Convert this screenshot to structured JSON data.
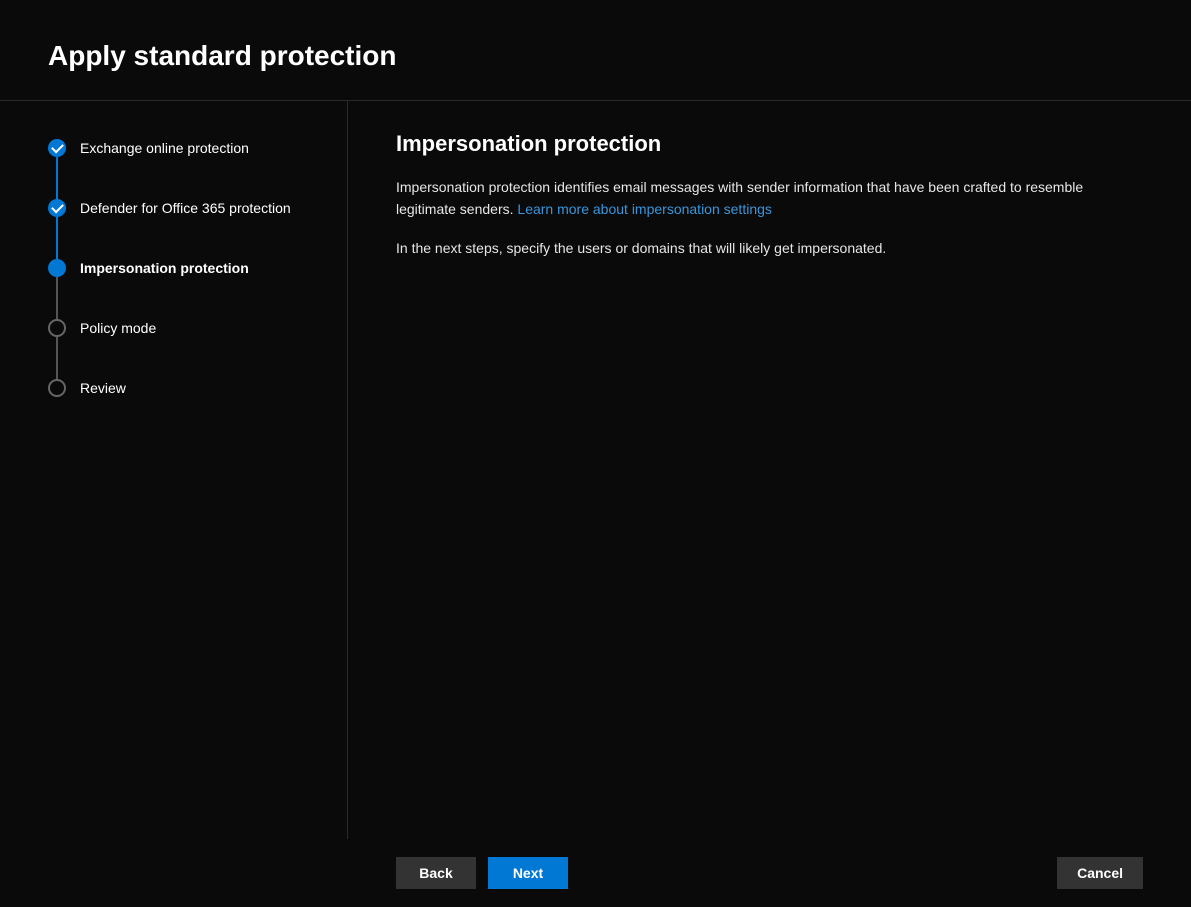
{
  "header": {
    "title": "Apply standard protection"
  },
  "steps": [
    {
      "label": "Exchange online protection",
      "state": "completed"
    },
    {
      "label": "Defender for Office 365 protection",
      "state": "completed"
    },
    {
      "label": "Impersonation protection",
      "state": "current"
    },
    {
      "label": "Policy mode",
      "state": "pending"
    },
    {
      "label": "Review",
      "state": "pending"
    }
  ],
  "content": {
    "heading": "Impersonation protection",
    "paragraph1_prefix": "Impersonation protection identifies email messages with sender information that have been crafted to resemble legitimate senders. ",
    "learn_more_link": "Learn more about impersonation settings",
    "paragraph2": "In the next steps, specify the users or domains that will likely get impersonated."
  },
  "footer": {
    "back": "Back",
    "next": "Next",
    "cancel": "Cancel"
  }
}
